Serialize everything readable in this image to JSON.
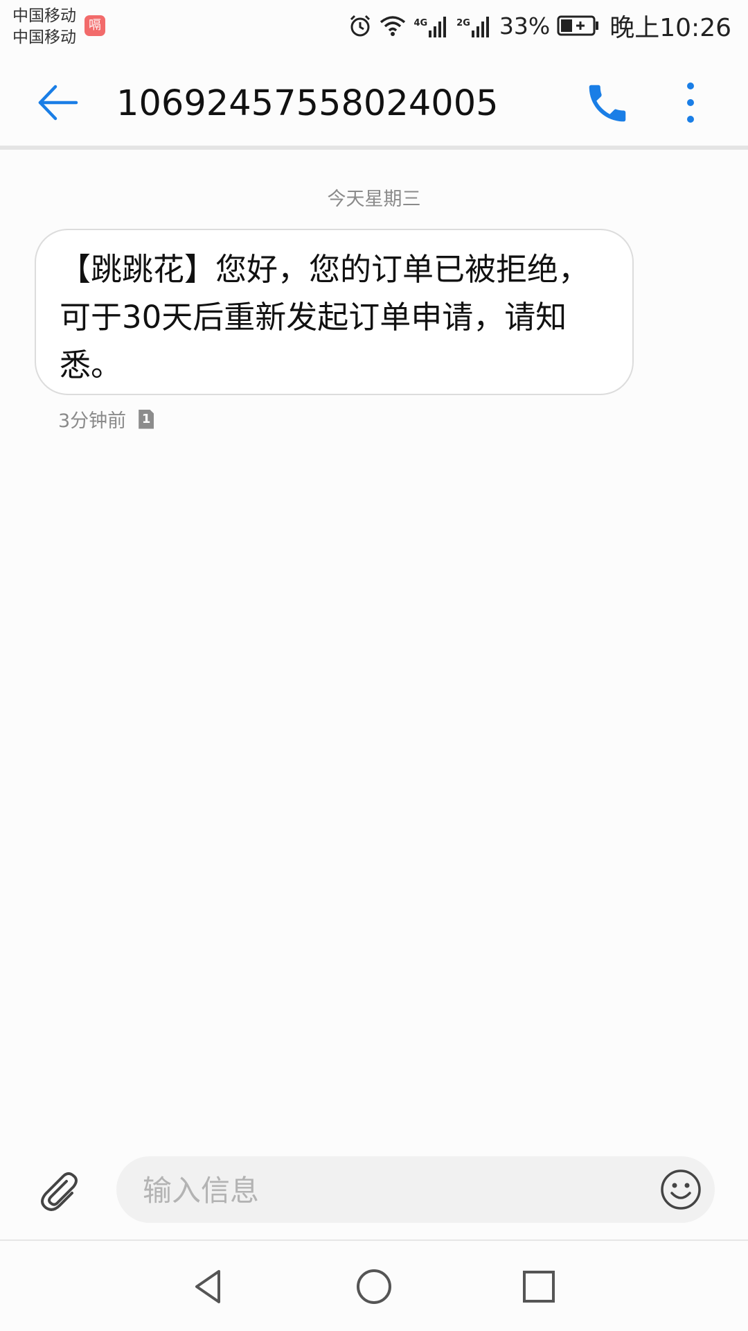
{
  "status_bar": {
    "carrier_1": "中国移动",
    "carrier_2": "中国移动",
    "carrier_badge": "嗝",
    "net_1": "4G",
    "net_2": "2G",
    "battery_pct": "33%",
    "time": "晚上10:26"
  },
  "header": {
    "title": "10692457558024005"
  },
  "conversation": {
    "date_separator": "今天星期三",
    "message": {
      "text": "【跳跳花】您好，您的订单已被拒绝，可于30天后重新发起订单申请，请知悉。",
      "time": "3分钟前",
      "sim": "1"
    }
  },
  "composer": {
    "placeholder": "输入信息"
  },
  "colors": {
    "accent": "#1a7ee6",
    "text": "#111111",
    "secondary": "#8a8a8a",
    "carrier_badge": "#f26b6b"
  },
  "icons": {
    "back": "arrow-left-icon",
    "call": "phone-icon",
    "more": "more-vertical-icon",
    "attach": "paperclip-icon",
    "emoji": "smiley-icon",
    "nav_back": "triangle-back-icon",
    "nav_home": "circle-home-icon",
    "nav_recent": "square-recent-icon"
  }
}
